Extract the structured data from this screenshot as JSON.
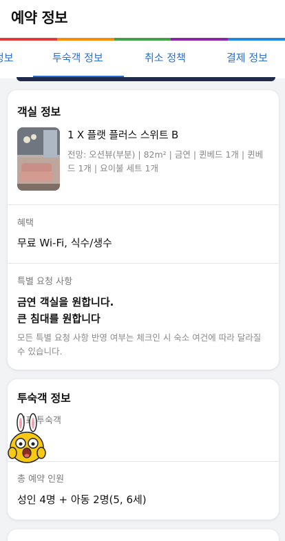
{
  "header": {
    "title": "예약 정보"
  },
  "rainbow_colors": [
    "#e53935",
    "#fb8c00",
    "#43a047",
    "#8e24aa",
    "#1e88e5"
  ],
  "tabs": [
    {
      "label": "정보"
    },
    {
      "label": "투숙객 정보"
    },
    {
      "label": "취소 정책"
    },
    {
      "label": "결제 정보"
    }
  ],
  "room_card": {
    "title": "객실 정보",
    "room_name": "1 X 플랫 플러스 스위트 B",
    "room_details": "전망: 오션뷰(부분) | 82m² | 금연 | 퀸베드 1개 | 퀸베드 1개 | 요이불 세트 1개",
    "benefits_label": "혜택",
    "benefits_value": "무료 Wi-Fi, 식수/생수",
    "requests_label": "특별 요청 사항",
    "request_1": "금연 객실을 원합니다.",
    "request_2": "큰 침대를 원합니다",
    "request_note": "모든 특별 요청 사항 반영 여부는 체크인 시 숙소 여건에 따라 달라질 수 있습니다."
  },
  "guest_card": {
    "title": "투숙객 정보",
    "representative_label": "대표 투숙객",
    "total_guests_label": "총 예약 인원",
    "total_guests_value": "성인 4명 + 아동 2명(5, 6세)"
  }
}
